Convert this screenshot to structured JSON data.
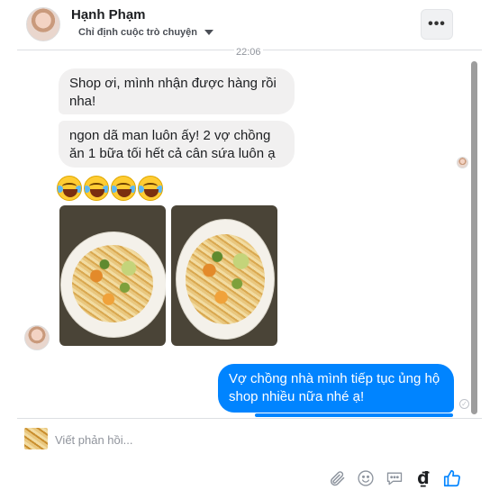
{
  "header": {
    "name": "Hạnh Phạm",
    "assign_label": "Chỉ định cuộc trò chuyện",
    "more_label": "•••"
  },
  "timestamp": "22:06",
  "messages": {
    "incoming": [
      "Shop ơi, mình nhận được hàng rồi nha!",
      "ngon dã man luôn ấy! 2 vợ chồng ăn 1 bữa tối hết cả cân sứa luôn ạ"
    ],
    "emoji_count": 4,
    "photos": [
      "food-photo-1",
      "food-photo-2"
    ],
    "outgoing": "Vợ chồng nhà mình tiếp tục ủng hộ shop nhiều nữa nhé ạ!"
  },
  "composer": {
    "placeholder": "Viết phản hồi...",
    "currency_symbol": "₫"
  },
  "icons": [
    "paperclip-icon",
    "emoji-icon",
    "quick-reply-icon",
    "currency-icon",
    "like-icon"
  ],
  "colors": {
    "outgoing_bubble": "#0084ff",
    "incoming_bubble": "#f1f0f0",
    "accent": "#0084ff"
  }
}
